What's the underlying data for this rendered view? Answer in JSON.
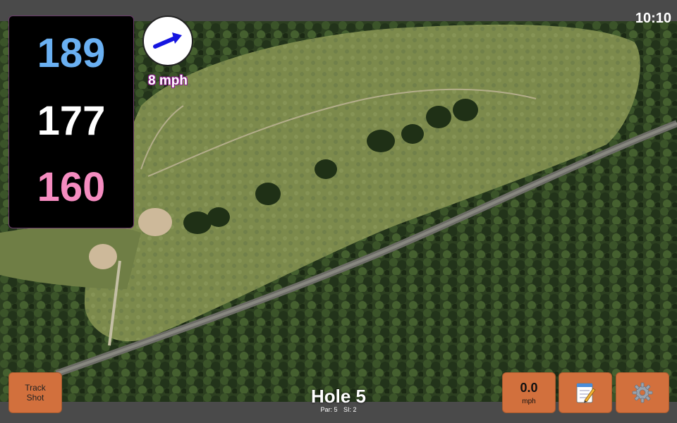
{
  "status": {
    "time": "10:10"
  },
  "distances": {
    "back": "189",
    "middle": "177",
    "front": "160"
  },
  "wind": {
    "speed": "8 mph",
    "icon": "wind-direction-arrow-icon"
  },
  "buttons": {
    "track_shot_line1": "Track",
    "track_shot_line2": "Shot",
    "speed_value": "0.0",
    "speed_unit": "mph",
    "notes_icon": "notepad-icon",
    "settings_icon": "gear-icon"
  },
  "hole": {
    "title": "Hole 5",
    "par": "Par: 5",
    "si": "SI: 2"
  },
  "colors": {
    "back": "#6ab0f2",
    "middle": "#ffffff",
    "front": "#f58cc0",
    "button": "#d2703d",
    "bar": "#4a4a4a"
  }
}
